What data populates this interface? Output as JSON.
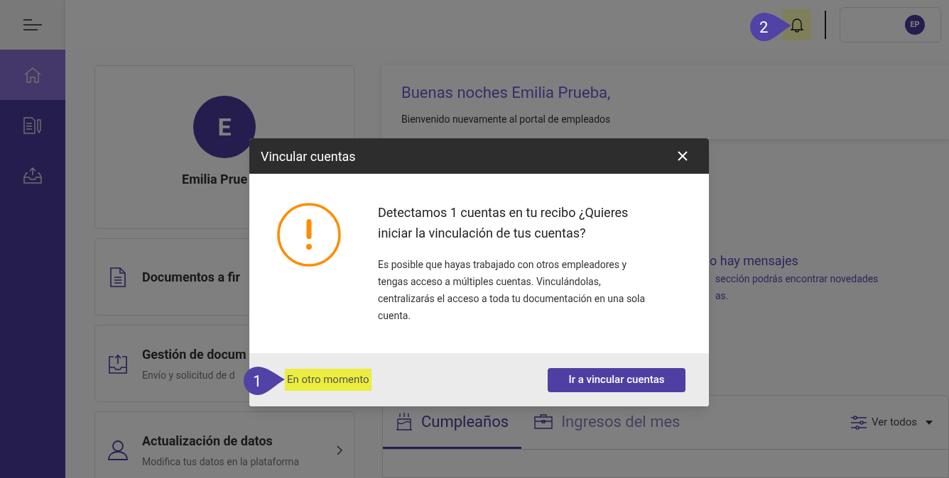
{
  "sidebar": {
    "items": [
      {
        "selected": true
      },
      {
        "selected": false
      },
      {
        "selected": false
      }
    ]
  },
  "header": {
    "user_initials": "EP"
  },
  "profile_card": {
    "initial": "E",
    "name": "Emilia Prue"
  },
  "shortcut_cards": [
    {
      "title": "Documentos a fir"
    },
    {
      "title": "Gestión de docum",
      "subtitle": "Envío y solicitud de d"
    },
    {
      "title": "Actualización de datos",
      "subtitle": "Modifica tus datos en la plataforma"
    }
  ],
  "greeting": {
    "title": "Buenas noches Emilia Prueba,",
    "subtitle": "Bienvenido nuevamente al portal de empleados"
  },
  "messages": {
    "title": "o hay mensajes",
    "lines": [
      "sección podrás encontrar novedades",
      "as."
    ]
  },
  "events_card": {
    "tabs": [
      {
        "label": "Cumpleaños",
        "selected": true
      },
      {
        "label": "Ingresos del mes",
        "selected": false
      }
    ],
    "filter": "Ver todos"
  },
  "dialog": {
    "title": "Vincular cuentas",
    "heading": "Detectamos 1 cuentas en tu recibo ¿Quieres iniciar la vinculación de tus cuentas?",
    "body": "Es posible que hayas trabajado con otros empleadores y tengas acceso a múltiples cuentas. Vinculándolas, centralizarás el acceso a toda tu documentación en una sola cuenta.",
    "secondary_action": "En otro momento",
    "primary_action": "Ir a vincular cuentas"
  },
  "callouts": [
    "1",
    "2"
  ]
}
